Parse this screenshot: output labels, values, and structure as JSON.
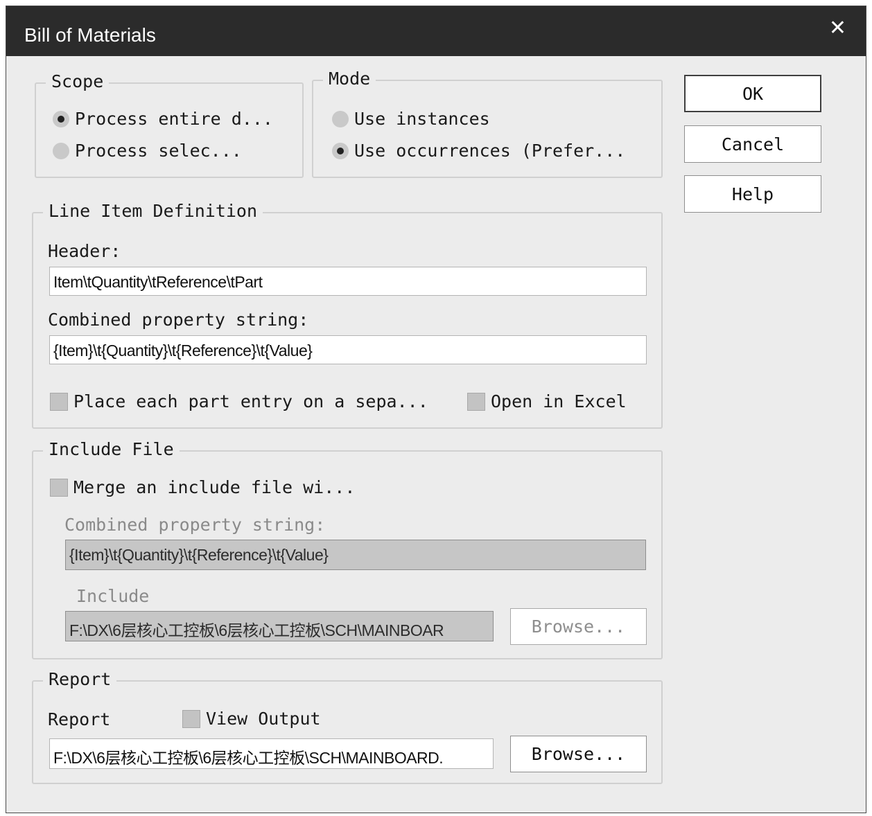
{
  "window": {
    "title": "Bill of Materials",
    "close_glyph": "✕"
  },
  "scope": {
    "legend": "Scope",
    "options": [
      {
        "label": "Process entire d...",
        "checked": true
      },
      {
        "label": "Process selec...",
        "checked": false
      }
    ]
  },
  "mode": {
    "legend": "Mode",
    "options": [
      {
        "label": "Use instances",
        "checked": false
      },
      {
        "label": "Use occurrences (Prefer...",
        "checked": true
      }
    ]
  },
  "buttons": {
    "ok": "OK",
    "cancel": "Cancel",
    "help": "Help"
  },
  "line_item": {
    "legend": "Line Item Definition",
    "header_label": "Header:",
    "header_value": "Item\\tQuantity\\tReference\\tPart",
    "combined_label": "Combined property string:",
    "combined_value": "{Item}\\t{Quantity}\\t{Reference}\\t{Value}",
    "separate_line_label": "Place each part entry on a sepa...",
    "open_excel_label": "Open in Excel"
  },
  "include_file": {
    "legend": "Include File",
    "merge_label": "Merge an include file wi...",
    "combined_label": "Combined property string:",
    "combined_value": "{Item}\\t{Quantity}\\t{Reference}\\t{Value}",
    "include_label": "Include",
    "include_path": "F:\\DX\\6层核心工控板\\6层核心工控板\\SCH\\MAINBOAR",
    "browse_label": "Browse..."
  },
  "report": {
    "legend": "Report",
    "report_label": "Report",
    "view_output_label": "View Output",
    "report_path": "F:\\DX\\6层核心工控板\\6层核心工控板\\SCH\\MAINBOARD.",
    "browse_label": "Browse..."
  }
}
